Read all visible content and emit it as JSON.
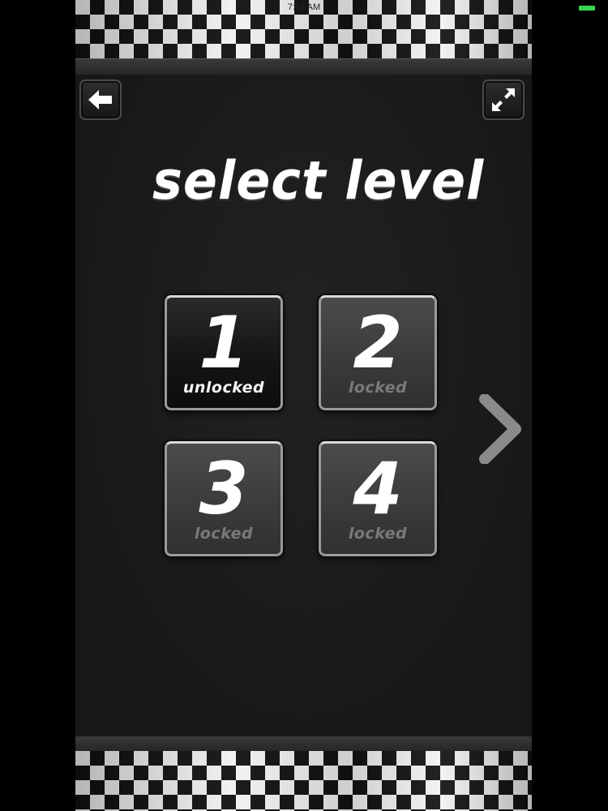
{
  "status_bar": {
    "time": "7:13 AM",
    "battery_color": "#39d353"
  },
  "header": {
    "back_icon": "arrow-left-icon",
    "fullscreen_icon": "expand-arrows-icon"
  },
  "title": "select level",
  "levels": [
    {
      "number": "1",
      "state": "unlocked"
    },
    {
      "number": "2",
      "state": "locked"
    },
    {
      "number": "3",
      "state": "locked"
    },
    {
      "number": "4",
      "state": "locked"
    }
  ],
  "pager": {
    "next_icon": "chevron-right-icon"
  },
  "colors": {
    "background": "#1b1b1d",
    "locked_text": "#7a7a7c",
    "unlocked_text": "#f4f4f4",
    "accent_gray": "#8a8a8c"
  }
}
